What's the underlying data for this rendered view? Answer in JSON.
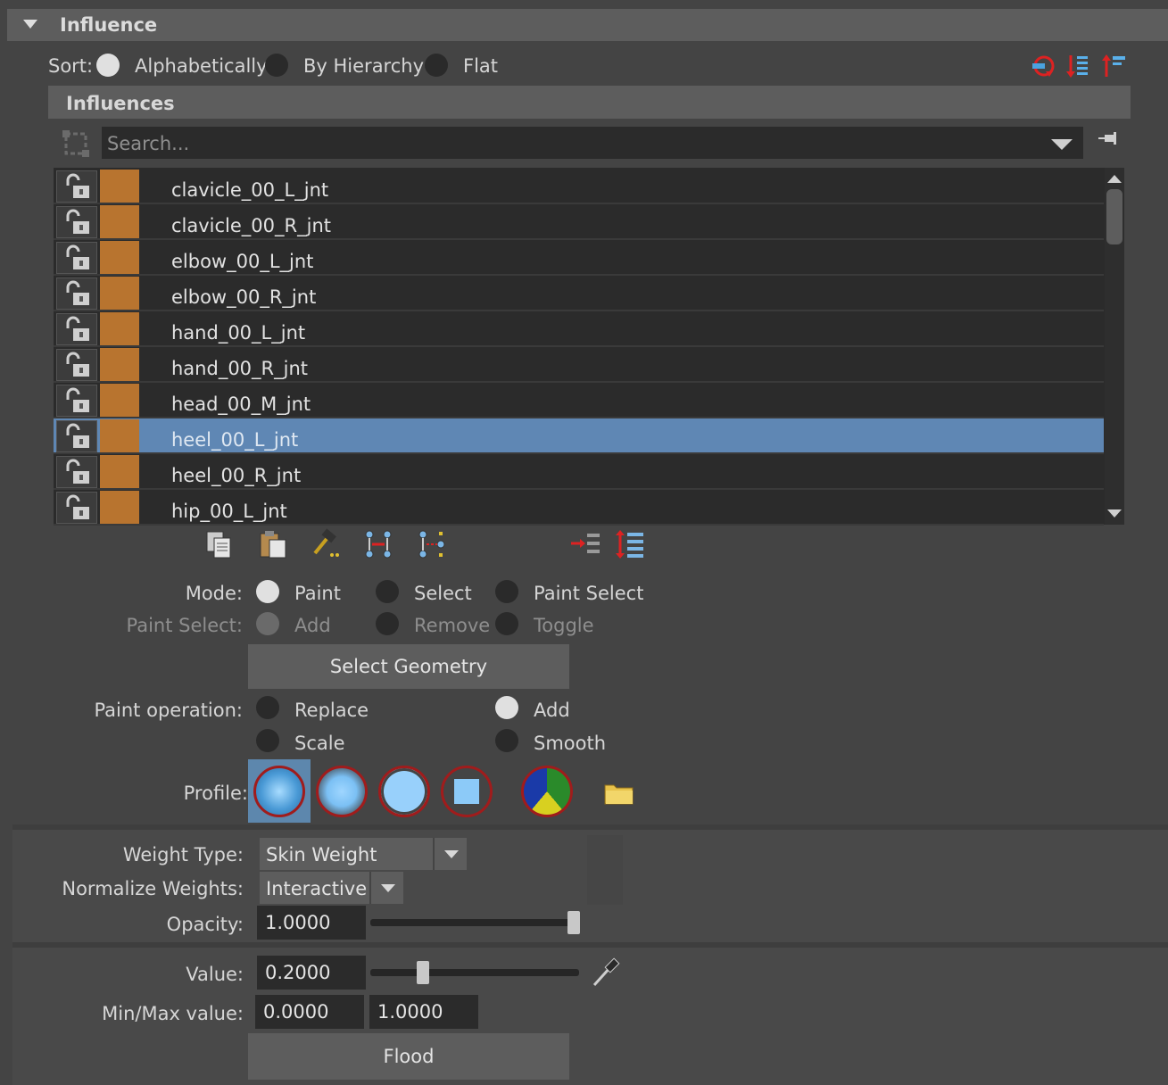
{
  "section": {
    "title": "Influence"
  },
  "sort": {
    "label": "Sort:",
    "options": [
      "Alphabetically",
      "By Hierarchy",
      "Flat"
    ],
    "selected": "Alphabetically"
  },
  "influences": {
    "title": "Influences",
    "search_placeholder": "Search...",
    "rows": [
      {
        "name": "clavicle_00_L_jnt",
        "selected": false
      },
      {
        "name": "clavicle_00_R_jnt",
        "selected": false
      },
      {
        "name": "elbow_00_L_jnt",
        "selected": false
      },
      {
        "name": "elbow_00_R_jnt",
        "selected": false
      },
      {
        "name": "hand_00_L_jnt",
        "selected": false
      },
      {
        "name": "hand_00_R_jnt",
        "selected": false
      },
      {
        "name": "head_00_M_jnt",
        "selected": false
      },
      {
        "name": "heel_00_L_jnt",
        "selected": true
      },
      {
        "name": "heel_00_R_jnt",
        "selected": false
      },
      {
        "name": "hip_00_L_jnt",
        "selected": false
      }
    ],
    "swatch_color": "#b8742f",
    "selection_color": "#5f87b4"
  },
  "mode": {
    "label": "Mode:",
    "options": [
      "Paint",
      "Select",
      "Paint Select"
    ],
    "selected": "Paint"
  },
  "paint_select": {
    "label": "Paint Select:",
    "options": [
      "Add",
      "Remove",
      "Toggle"
    ],
    "selected": "Add"
  },
  "select_geometry_label": "Select Geometry",
  "paint_operation": {
    "label": "Paint operation:",
    "options": [
      "Replace",
      "Add",
      "Scale",
      "Smooth"
    ],
    "selected": "Add"
  },
  "profile": {
    "label": "Profile:"
  },
  "weight_type": {
    "label": "Weight Type:",
    "value": "Skin Weight"
  },
  "normalize_weights": {
    "label": "Normalize Weights:",
    "value": "Interactive"
  },
  "opacity": {
    "label": "Opacity:",
    "value": "1.0000",
    "fraction": 1.0
  },
  "value": {
    "label": "Value:",
    "value": "0.2000",
    "fraction": 0.2
  },
  "min_max": {
    "label": "Min/Max value:",
    "min": "0.0000",
    "max": "1.0000"
  },
  "flood_label": "Flood"
}
